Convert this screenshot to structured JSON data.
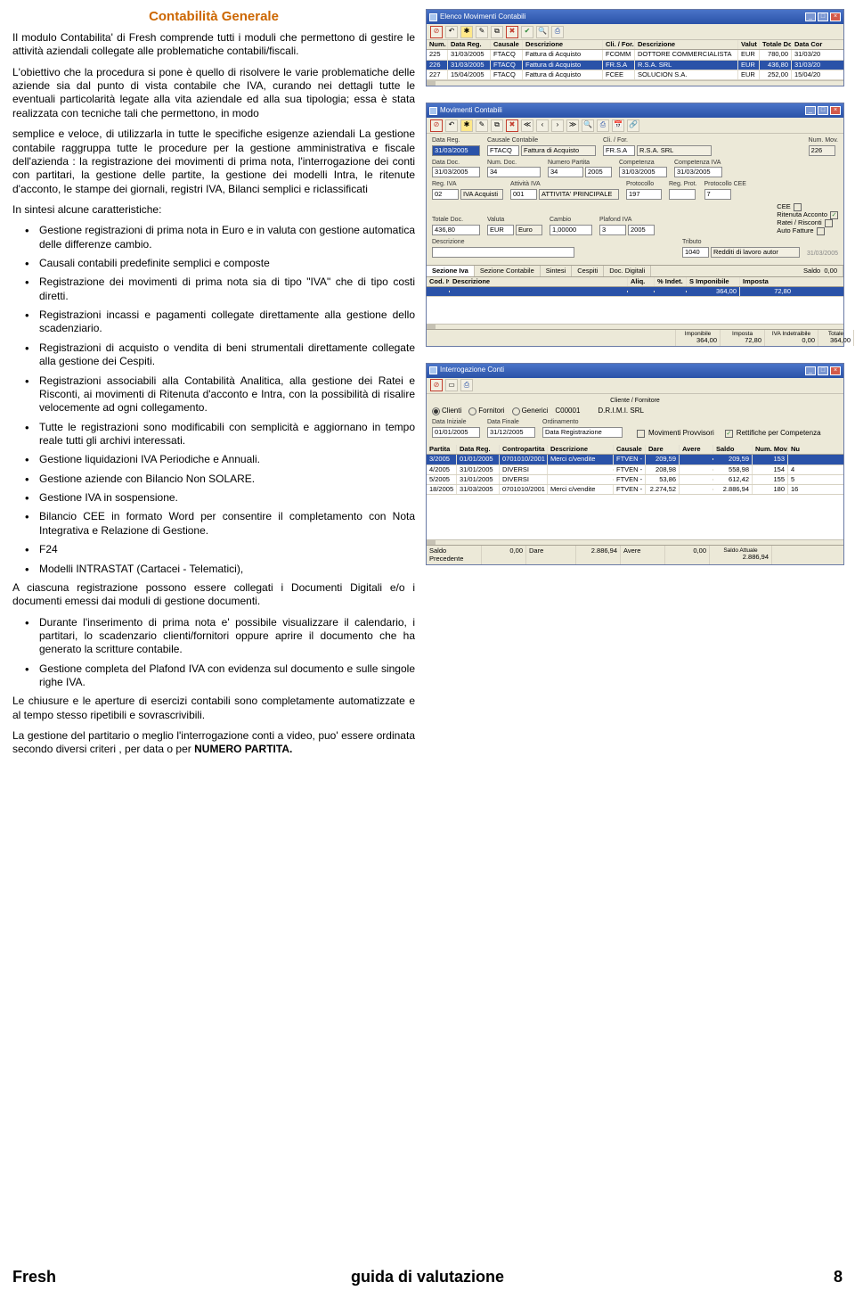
{
  "doc": {
    "title": "Contabilità Generale",
    "para1": "Il modulo Contabilita' di Fresh comprende tutti i moduli che permettono di gestire le attività aziendali collegate alle problematiche contabili/fiscali.",
    "para2": "L'obiettivo che la procedura si pone è quello di risolvere le varie problematiche delle aziende sia dal punto di vista contabile che IVA, curando nei dettagli tutte le eventuali particolarità legate alla vita aziendale ed alla sua tipologia; essa è stata realizzata con tecniche tali che permettono, in modo",
    "para3": "semplice e veloce, di utilizzarla in tutte le specifiche esigenze aziendali La gestione contabile raggruppa tutte le procedure per la gestione amministrativa e fiscale dell'azienda : la registrazione dei movimenti di prima nota, l'interrogazione dei conti con partitari, la gestione delle partite, la gestione dei modelli Intra, le ritenute d'acconto, le stampe dei giornali, registri IVA, Bilanci semplici e riclassificati",
    "para4": "In sintesi alcune caratteristiche:",
    "bullets1": [
      "Gestione registrazioni di prima nota in Euro e in valuta con gestione automatica delle differenze cambio.",
      "Causali contabili predefinite semplici e composte",
      "Registrazione dei movimenti di prima nota sia di tipo \"IVA\" che di tipo costi diretti.",
      "Registrazioni incassi e pagamenti collegate direttamente alla gestione dello scadenziario.",
      "Registrazioni di acquisto o vendita di beni strumentali direttamente collegate alla gestione dei Cespiti.",
      "Registrazioni associabili alla Contabilità Analitica, alla gestione dei Ratei e Risconti, ai movimenti di Ritenuta d'acconto e Intra, con la possibilità di risalire velocemente ad ogni collegamento.",
      "Tutte le registrazioni sono modificabili con semplicità e aggiornano in tempo reale tutti gli archivi interessati.",
      "Gestione liquidazioni IVA Periodiche e Annuali.",
      "Gestione aziende con Bilancio Non SOLARE.",
      "Gestione IVA in sospensione.",
      "Bilancio CEE in formato Word per consentire il completamento con Nota Integrativa e Relazione di Gestione.",
      "F24",
      "Modelli INTRASTAT (Cartacei - Telematici),"
    ],
    "para5": "A ciascuna registrazione possono essere collegati i Documenti Digitali e/o i documenti emessi dai moduli di gestione documenti.",
    "bullets2": [
      "Durante l'inserimento di prima nota e' possibile visualizzare il calendario, i partitari, lo scadenzario clienti/fornitori oppure aprire il documento che ha generato la scritture contabile.",
      "Gestione completa del  Plafond IVA con evidenza sul documento e sulle singole righe IVA."
    ],
    "para6": "Le chiusure e le aperture di esercizi  contabili sono completamente automatizzate e al tempo stesso ripetibili e sovrascrivibili.",
    "para7a": "La gestione del partitario o meglio l'interrogazione conti a video, puo' essere ordinata secondo diversi criteri , per data o per ",
    "para7b": "NUMERO PARTITA."
  },
  "footer": {
    "left": "Fresh",
    "center": "guida di valutazione",
    "right": "8"
  },
  "elenco": {
    "title": "Elenco Movimenti Contabili",
    "headers": [
      "Num. Mov.",
      "Data Reg.",
      "Causale",
      "Descrizione",
      "Cli. / For.",
      "Descrizione",
      "Valut",
      "Totale Do",
      "Data Cor"
    ],
    "rows": [
      [
        "225",
        "31/03/2005",
        "FTACQ",
        "Fattura di Acquisto",
        "FCOMM",
        "DOTTORE COMMERCIALISTA",
        "EUR",
        "780,00",
        "31/03/20"
      ],
      [
        "226",
        "31/03/2005",
        "FTACQ",
        "Fattura di Acquisto",
        "FR.S.A",
        "R.S.A. SRL",
        "EUR",
        "436,80",
        "31/03/20"
      ],
      [
        "227",
        "15/04/2005",
        "FTACQ",
        "Fattura di Acquisto",
        "FCEE",
        "SOLUCION S.A.",
        "EUR",
        "252,00",
        "15/04/20"
      ]
    ]
  },
  "mov": {
    "title": "Movimenti Contabili",
    "row1": {
      "labDataReg": "Data Reg.",
      "dataReg": "31/03/2005",
      "labCausale": "Causale Contabile",
      "causaleCod": "FTACQ",
      "causaleDesc": "Fattura di Acquisto",
      "labCliFor": "Cli. / For.",
      "cliForCod": "FR.S.A",
      "cliForDesc": "R.S.A. SRL",
      "labNumMov": "Num. Mov.",
      "numMov": "226"
    },
    "row2": {
      "labDataDoc": "Data Doc.",
      "dataDoc": "31/03/2005",
      "labNumDoc": "Num. Doc.",
      "numDoc": "34",
      "labNumPart": "Numero Partita",
      "numPart": "34",
      "numPartAnno": "2005",
      "labComp": "Competenza",
      "comp": "31/03/2005",
      "labCompIva": "Competenza IVA",
      "compIva": "31/03/2005"
    },
    "row3": {
      "labRegIva": "Reg. IVA",
      "regIva": "02",
      "regIvaDesc": "IVA Acquisti",
      "labAttIva": "Attività IVA",
      "attIva": "001",
      "attIvaDesc": "ATTIVITA' PRINCIPALE",
      "labProt": "Protocollo",
      "prot": "197",
      "labRegProt": "Reg. Prot.",
      "regProt": "",
      "labProtCee": "Protocollo CEE",
      "protCee": "7"
    },
    "row4": {
      "labTotDoc": "Totale Doc.",
      "totDoc": "436,80",
      "labValuta": "Valuta",
      "valutaCod": "EUR",
      "valutaDesc": "Euro",
      "labCambio": "Cambio",
      "cambio": "1,00000",
      "labPlafond": "Plafond IVA",
      "plaMese": "3",
      "plaAnno": "2005",
      "labCee": "CEE",
      "labRiten": "Ritenuta Acconto",
      "labRatei": "Ratei / Risconti",
      "labAuto": "Auto Fatture"
    },
    "row5": {
      "labDescr": "Descrizione",
      "descr": "",
      "labTrib": "Tributo",
      "tribCod": "1040",
      "tribDesc": "Redditi di lavoro autor"
    },
    "tabs": [
      "Sezione Iva",
      "Sezione Contabile",
      "Sintesi",
      "Cespiti",
      "Doc. Digitali"
    ],
    "sezHeaders": [
      "Cod. Iva",
      "Descrizione",
      "Aliq.",
      "% Indet.",
      "S Imponibile",
      "Imposta"
    ],
    "sezRow": [
      "",
      "",
      "",
      "",
      "364,00",
      "72,80"
    ],
    "labSaldo": "Saldo",
    "saldo": "0,00",
    "totLabelImp": "Imponibile",
    "totLabelImposta": "Imposta",
    "totLabelIndet": "IVA Indetraibile",
    "totLabelTot": "Totale",
    "totImp": "364,00",
    "totImposta": "72,80",
    "totIndet": "0,00",
    "totTot": "364,00",
    "date": "31/03/2005"
  },
  "int": {
    "title": "Interrogazione Conti",
    "group": "Cliente / Fornitore",
    "radios": [
      "Clienti",
      "Fornitori",
      "Generici"
    ],
    "radioSel": 0,
    "contoCod": "C00001",
    "contoDesc": "D.R.I.M.I. SRL",
    "labDataIni": "Data Iniziale",
    "dataIni": "01/01/2005",
    "labDataFin": "Data Finale",
    "dataFin": "31/12/2005",
    "labOrd": "Ordinamento",
    "ord": "Data Registrazione",
    "chk1": "Movimenti Provvisori",
    "chk2": "Rettifiche per Competenza",
    "headers": [
      "Partita",
      "Data Reg.",
      "Contropartita",
      "Descrizione",
      "Causale",
      "Dare",
      "Avere",
      "Saldo",
      "Num. Mov.",
      "Nu"
    ],
    "rows": [
      [
        "3/2005",
        "01/01/2005",
        "0701010/2001",
        "Merci c/vendite",
        "FTVEN -",
        "209,59",
        "",
        "209,59",
        "153",
        ""
      ],
      [
        "4/2005",
        "31/01/2005",
        "DIVERSI",
        "",
        "FTVEN -",
        "208,98",
        "",
        "558,98",
        "154",
        "4"
      ],
      [
        "5/2005",
        "31/01/2005",
        "DIVERSI",
        "",
        "FTVEN -",
        "53,86",
        "",
        "612,42",
        "155",
        "5"
      ],
      [
        "18/2005",
        "31/03/2005",
        "0701010/2001",
        "Merci c/vendite",
        "FTVEN -",
        "2.274,52",
        "",
        "2.886,94",
        "180",
        "16"
      ]
    ],
    "tot": {
      "labPrec": "Saldo Precedente",
      "prec": "0,00",
      "labDare": "Dare",
      "dare": "2.886,94",
      "labAvere": "Avere",
      "avere": "0,00",
      "labSaldo": "Saldo Attuale",
      "saldo": "2.886,94"
    }
  }
}
